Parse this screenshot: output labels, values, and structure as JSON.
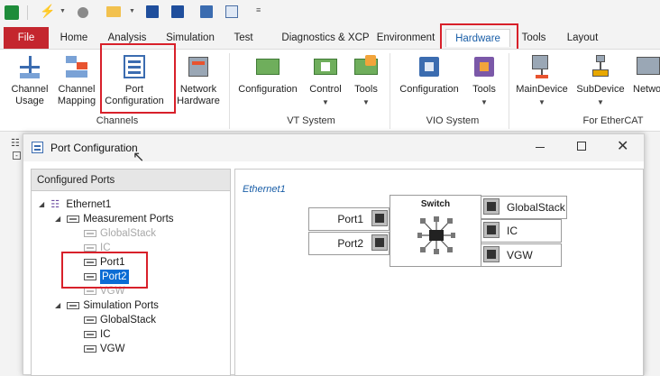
{
  "ribbon_tabs": [
    "File",
    "Home",
    "Analysis",
    "Simulation",
    "Test",
    "Diagnostics & XCP",
    "Environment",
    "Hardware",
    "Tools",
    "Layout"
  ],
  "ribbon": {
    "channels": {
      "group_label": "Channels",
      "buttons": [
        {
          "line1": "Channel",
          "line2": "Usage"
        },
        {
          "line1": "Channel",
          "line2": "Mapping"
        },
        {
          "line1": "Port",
          "line2": "Configuration"
        },
        {
          "line1": "Network",
          "line2": "Hardware"
        }
      ]
    },
    "vt_system": {
      "group_label": "VT System",
      "buttons": [
        {
          "line1": "Configuration"
        },
        {
          "line1": "Control"
        },
        {
          "line1": "Tools"
        }
      ]
    },
    "vio_system": {
      "group_label": "VIO System",
      "buttons": [
        {
          "line1": "Configuration"
        },
        {
          "line1": "Tools"
        }
      ]
    },
    "ethercat": {
      "group_label": "For EtherCAT",
      "buttons": [
        {
          "line1": "MainDevice"
        },
        {
          "line1": "SubDevice"
        },
        {
          "line1": "Netwo"
        }
      ]
    }
  },
  "dialog": {
    "title": "Port Configuration",
    "tree_header": "Configured Ports",
    "tree": {
      "root": "Ethernet1",
      "measurement": "Measurement Ports",
      "m_items": [
        "GlobalStack",
        "IC",
        "Port1",
        "Port2",
        "VGW"
      ],
      "simulation": "Simulation Ports",
      "s_items": [
        "GlobalStack",
        "IC",
        "VGW"
      ]
    },
    "diagram": {
      "network_label": "Ethernet1",
      "switch_label": "Switch",
      "left_ports": [
        "Port1",
        "Port2"
      ],
      "right_ports": [
        "GlobalStack",
        "IC",
        "VGW"
      ]
    }
  },
  "colors": {
    "file_tab": "#c4262e",
    "highlight": "#d8202a",
    "selection": "#0b6cd4"
  }
}
